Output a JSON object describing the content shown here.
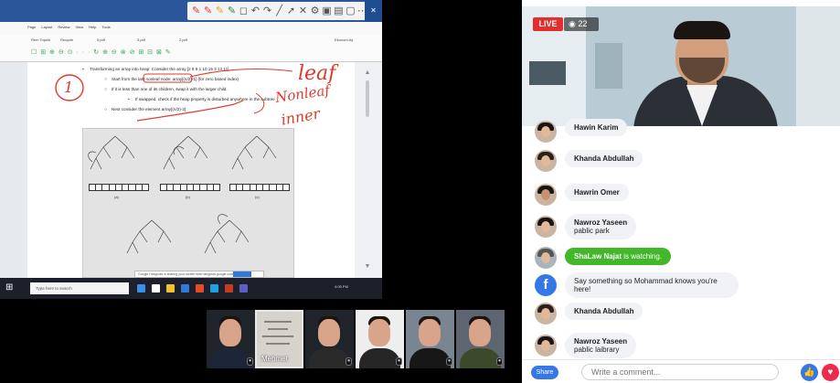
{
  "screen": {
    "ribbon_tabs": [
      "Page",
      "Layout",
      "Review",
      "View",
      "Help",
      "Tools"
    ],
    "doc_tabs": [
      "Rem Topolk",
      "Recycle",
      "5.pdf",
      "3.pdf",
      "2.pdf",
      "Ekonom Aş"
    ],
    "ribbon_icons": "☐ ⊞ ⊕ ⊖ ⊙ · · · ↻ ⊕ ⊖ ⊗ ⊘ ⊞ ⊟ ⊠ ✎",
    "lines": [
      "Transforming an array into heap: Consider the array [2 8 6 1 10 15 3 12 11]",
      "Start from the last nonleaf node: array[(n/2)-1] (for zero based index)",
      "If it is less than one of its children, swap it with the larger child.",
      "If swapped, check if the heap property is disturbed anywhere in the subtree",
      "Next consider the element array[(n/2)-2]"
    ],
    "ink": {
      "circle_number": "1",
      "word_leaf": "leaf",
      "word_nonleaf": "Nonleaf",
      "word_inner": "inner"
    },
    "figure_labels": [
      "(a)",
      "(b)",
      "(c)"
    ],
    "notification": "Google Hangouts is sharing your screen with hangouts.google.com",
    "taskbar": {
      "search_placeholder": "Type here to search",
      "clock": "4:05 PM"
    }
  },
  "participants": {
    "tiles": [
      {
        "name": ""
      },
      {
        "name": "Mehmet"
      },
      {
        "name": ""
      },
      {
        "name": ""
      },
      {
        "name": ""
      },
      {
        "name": ""
      }
    ]
  },
  "facebook_live": {
    "live_label": "LIVE",
    "viewer_count": "22",
    "comments": [
      {
        "name": "Hawin Karim",
        "text": ""
      },
      {
        "name": "Khanda Abdullah",
        "text": ""
      },
      {
        "name": "Hawrin Omer",
        "text": ""
      },
      {
        "name": "Nawroz Yaseen",
        "text": "pablic park"
      },
      {
        "name": "ShaLaw Najat",
        "text": "is watching."
      },
      {
        "name": "",
        "text": "Say something so Mohammad knows you're here!"
      },
      {
        "name": "Khanda Abdullah",
        "text": ""
      },
      {
        "name": "Nawroz Yaseen",
        "text": "pablic laibrary"
      }
    ],
    "composer": {
      "share_label": "Share",
      "placeholder": "Write a comment..."
    }
  },
  "colors": {
    "live_red": "#e42d2d",
    "facebook_blue": "#3578e5",
    "watching_green": "#42b72a",
    "ink_red": "#e0392b"
  }
}
